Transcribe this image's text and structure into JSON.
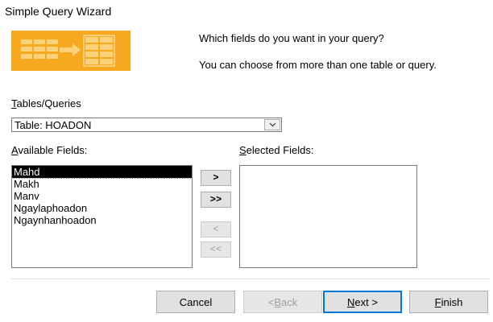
{
  "window": {
    "title": "Simple Query Wizard"
  },
  "prompt": {
    "line1": "Which fields do you want in your query?",
    "line2": "You can choose from more than one table or query."
  },
  "tables": {
    "label_mnemonic": "T",
    "label_rest": "ables/Queries",
    "selected_value": "Table: HOADON"
  },
  "available": {
    "label_mnemonic": "A",
    "label_rest": "vailable Fields:",
    "items": [
      "Mahd",
      "Makh",
      "Manv",
      "Ngaylaphoadon",
      "Ngaynhanhoadon"
    ],
    "selected_index": 0
  },
  "selected": {
    "label_mnemonic": "S",
    "label_rest": "elected Fields:",
    "items": []
  },
  "move_buttons": {
    "add_one": ">",
    "add_all": ">>",
    "remove_one": "<",
    "remove_all": "<<"
  },
  "footer": {
    "cancel": "Cancel",
    "back_prefix": "< ",
    "back_mnemonic": "B",
    "back_rest": "ack",
    "next_mnemonic": "N",
    "next_rest": "ext >",
    "finish_mnemonic": "F",
    "finish_rest": "inish"
  },
  "icons": {
    "dropdown": "chevron-down-icon",
    "illustration": "query-wizard-illustration"
  },
  "colors": {
    "illustration_orange": "#f5a623",
    "illustration_light": "#fbd27a",
    "default_button_border": "#0078d7",
    "selection_bg": "#000000"
  }
}
